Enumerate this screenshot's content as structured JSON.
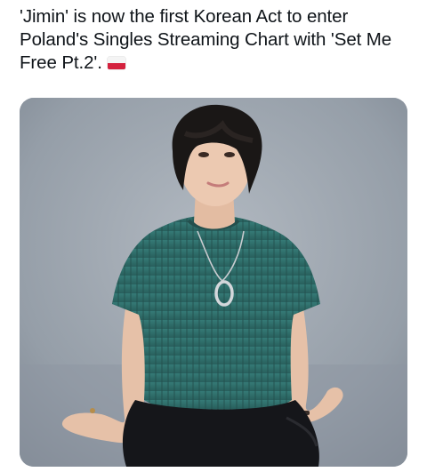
{
  "post": {
    "text": "'Jimin' is now the first Korean Act to enter Poland's Singles Streaming Chart with 'Set Me Free Pt.2'.",
    "flag_icon": "poland-flag-icon",
    "flag_colors": {
      "top": "#f4f4f4",
      "bottom": "#d4213d"
    }
  },
  "media": {
    "kind": "photo",
    "palette": {
      "backdrop": "#9aa3ad",
      "sweater": "#2f6f6b",
      "hair": "#1a1716",
      "skin": "#e9c6ae",
      "pants": "#15161a"
    }
  }
}
